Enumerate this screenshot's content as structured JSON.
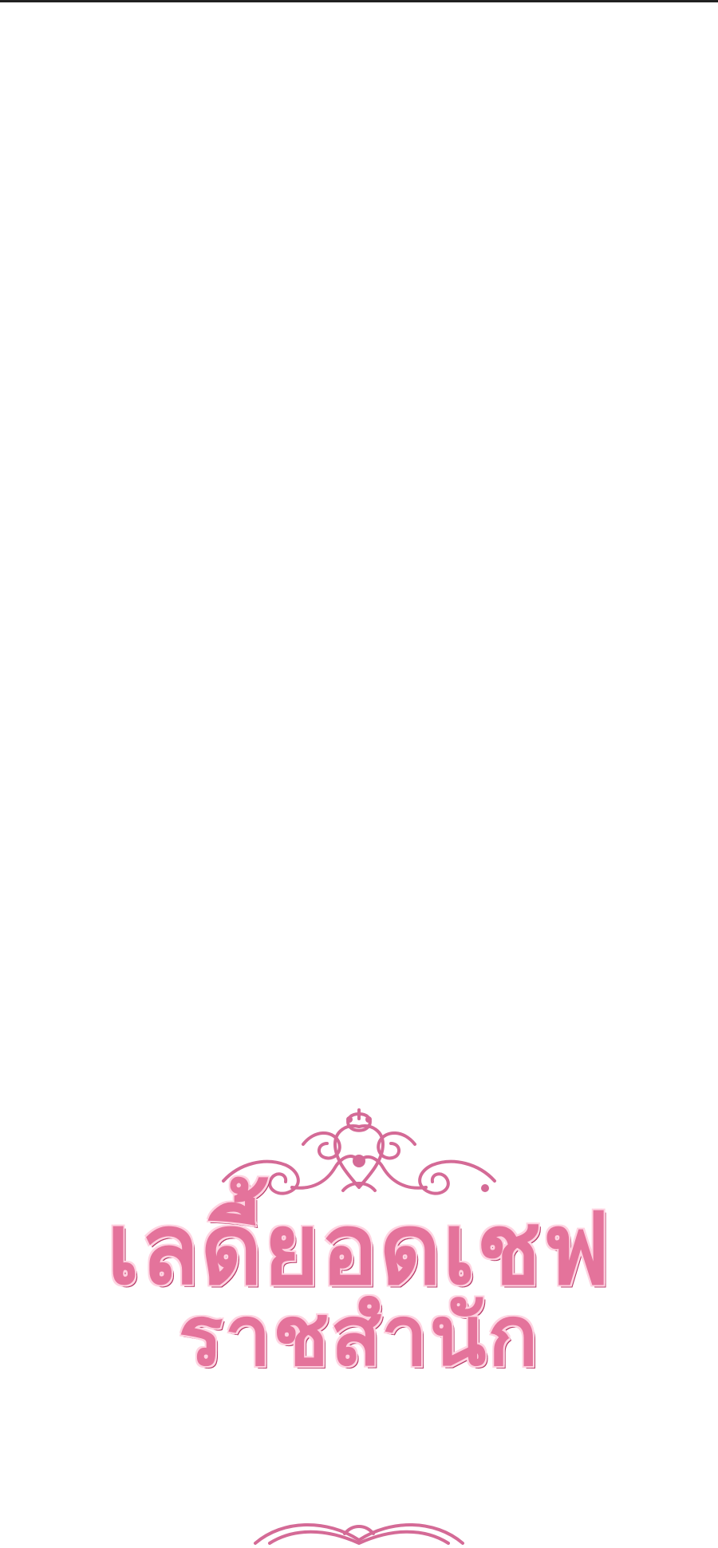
{
  "page": {
    "background_color": "#ffffff",
    "border_color": "#222222"
  },
  "logo": {
    "title_line_1": "เลดี้ยอดเชฟ",
    "title_line_2": "ราชสำนัก",
    "colors": {
      "fill": "#e4739b",
      "outline": "#b83b69",
      "ornament": "#d46a96"
    },
    "ornament_top_icon": "flourish-crown-ornament",
    "ornament_bottom_icon": "flourish-loop-ornament"
  }
}
